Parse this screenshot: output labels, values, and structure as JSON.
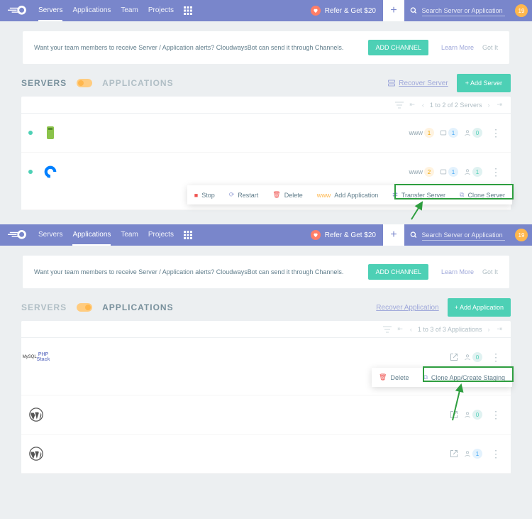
{
  "nav": {
    "servers": "Servers",
    "applications": "Applications",
    "team": "Team",
    "projects": "Projects"
  },
  "refer_label": "Refer & Get $20",
  "search_placeholder": "Search Server or Application",
  "notification_count": "19",
  "alert": {
    "message": "Want your team members to receive Server / Application alerts? CloudwaysBot can send it through Channels.",
    "add": "ADD CHANNEL",
    "learn": "Learn More",
    "gotit": "Got It"
  },
  "tabs": {
    "servers": "SERVERS",
    "applications": "APPLICATIONS"
  },
  "buttons": {
    "add_server": "Add Server",
    "add_application": "Add Application"
  },
  "recover_server": "Recover Server",
  "recover_app": "Recover Application",
  "page_servers": "1 to 2 of 2 Servers",
  "page_apps": "1 to 3 of 3 Applications",
  "row": {
    "www": "www",
    "one": "1",
    "two": "2",
    "zero": "0"
  },
  "ctx": {
    "stop": "Stop",
    "restart": "Restart",
    "delete": "Delete",
    "add_app": "Add Application",
    "transfer": "Transfer Server",
    "clone_server": "Clone Server",
    "clone_app": "Clone App/Create Staging"
  }
}
